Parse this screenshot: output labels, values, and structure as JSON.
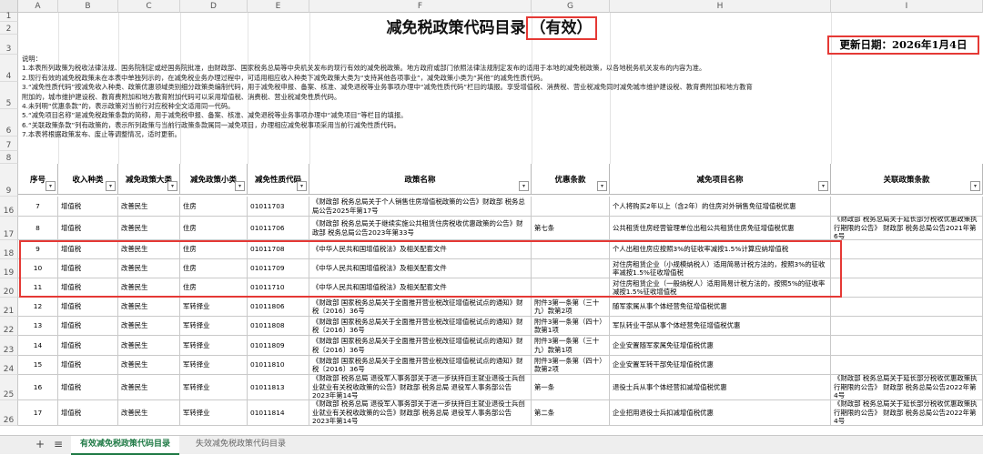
{
  "columns": [
    "A",
    "B",
    "C",
    "D",
    "E",
    "F",
    "G",
    "H",
    "I"
  ],
  "title_main": "减免税政策代码目录",
  "title_highlight": "（有效）",
  "update_date": "更新日期：2026年1月4日",
  "notes": [
    "说明：",
    "1.本表所列政策为税收法律法规、国务院制定或经国务院批准，由财政部、国家税务总局等中央机关发布的现行有效的减免税政策。地方政府或部门依照法律法规制定发布的适用于本地的减免税政策，以各地税务机关发布的内容为准。",
    "2.现行有效的减免税政策未在本表中单独列示的，在减免税业务办理过程中，可适用相应收入种类下减免政策大类为“支持其他各项事业”，减免政策小类为“其他”的减免性质代码。",
    "3.“减免性质代码”按减免收入种类、政策优惠领域类别细分政策类编制代码，用于减免税申报、备案、核准、减免退税等业务事项办理中“减免性质代码”栏目的填报。享受增值税、消费税、营业税减免同时减免城市维护建设税、教育费附加和地方教育",
    "附加的，城市维护建设税、教育费附加和地方教育附加代码可以采用增值税、消费税、营业税减免性质代码。",
    "4.未列明“优惠条款”的，表示政策对当前行对应税种全文适用同一代码。",
    "5.“减免项目名称”是减免税政策条款的简称，用于减免税申报、备案、核准、减免退税等业务事项办理中“减免项目”等栏目的填报。",
    "6.“关联政策条款”列有政策的，表示所列政策与当前行政策条款属同一减免项目，办理相应减免税事项采用当前行减免性质代码。",
    "7.本表将根据政策发布、废止等调整情况，适时更新。"
  ],
  "table_headers": [
    "序号",
    "收入种类",
    "减免政策大类",
    "减免政策小类",
    "减免性质代码",
    "政策名称",
    "优惠条款",
    "减免项目名称",
    "关联政策条款"
  ],
  "rows": [
    {
      "rn": "16",
      "seq": "7",
      "tax": "增值税",
      "cat": "改善民生",
      "sub": "住房",
      "code": "01011703",
      "policy": "《财政部 税务总局关于个人销售住房增值税政策的公告》财政部 税务总局公告2025年第17号",
      "clause": "",
      "item": "个人将购买2年以上（含2年）的住房对外销售免征增值税优惠",
      "related": ""
    },
    {
      "rn": "17",
      "seq": "8",
      "tax": "增值税",
      "cat": "改善民生",
      "sub": "住房",
      "code": "01011706",
      "policy": "《财政部 税务总局关于继续实施公共租赁住房税收优惠政策的公告》财政部 税务总局公告2023年第33号",
      "clause": "第七条",
      "item": "公共租赁住房经营管理单位出租公共租赁住房免征增值税优惠",
      "related": "《财政部 税务总局关于延长部分税收优惠政策执行期限的公告》 财政部 税务总局公告2021年第6号"
    },
    {
      "rn": "18",
      "seq": "9",
      "tax": "增值税",
      "cat": "改善民生",
      "sub": "住房",
      "code": "01011708",
      "policy": "《中华人民共和国增值税法》及相关配套文件",
      "clause": "",
      "item": "个人出租住房应按照3%的征收率减按1.5%计算应纳增值税",
      "related": ""
    },
    {
      "rn": "19",
      "seq": "10",
      "tax": "增值税",
      "cat": "改善民生",
      "sub": "住房",
      "code": "01011709",
      "policy": "《中华人民共和国增值税法》及相关配套文件",
      "clause": "",
      "item": "对住房租赁企业（小规模纳税人）适用简易计税方法的，按照3%的征收率减按1.5%征收增值税",
      "related": ""
    },
    {
      "rn": "20",
      "seq": "11",
      "tax": "增值税",
      "cat": "改善民生",
      "sub": "住房",
      "code": "01011710",
      "policy": "《中华人民共和国增值税法》及相关配套文件",
      "clause": "",
      "item": "对住房租赁企业（一般纳税人）适用简易计税方法的，按照5%的征收率减按1.5%征收增值税",
      "related": ""
    },
    {
      "rn": "21",
      "seq": "12",
      "tax": "增值税",
      "cat": "改善民生",
      "sub": "军转择业",
      "code": "01011806",
      "policy": "《财政部 国家税务总局关于全面推开营业税改征增值税试点的通知》财税〔2016〕36号",
      "clause": "附件3第一条第（三十九）款第2项",
      "item": "随军家属从事个体经营免征增值税优惠",
      "related": ""
    },
    {
      "rn": "22",
      "seq": "13",
      "tax": "增值税",
      "cat": "改善民生",
      "sub": "军转择业",
      "code": "01011808",
      "policy": "《财政部 国家税务总局关于全面推开营业税改征增值税试点的通知》财税〔2016〕36号",
      "clause": "附件3第一条第（四十）款第1项",
      "item": "军队转业干部从事个体经营免征增值税优惠",
      "related": ""
    },
    {
      "rn": "23",
      "seq": "14",
      "tax": "增值税",
      "cat": "改善民生",
      "sub": "军转择业",
      "code": "01011809",
      "policy": "《财政部 国家税务总局关于全面推开营业税改征增值税试点的通知》财税〔2016〕36号",
      "clause": "附件3第一条第（三十九）款第1项",
      "item": "企业安置随军家属免征增值税优惠",
      "related": ""
    },
    {
      "rn": "24",
      "seq": "15",
      "tax": "增值税",
      "cat": "改善民生",
      "sub": "军转择业",
      "code": "01011810",
      "policy": "《财政部 国家税务总局关于全面推开营业税改征增值税试点的通知》财税〔2016〕36号",
      "clause": "附件3第一条第（四十）款第2项",
      "item": "企业安置军转干部免征增值税优惠",
      "related": ""
    },
    {
      "rn": "25",
      "seq": "16",
      "tax": "增值税",
      "cat": "改善民生",
      "sub": "军转择业",
      "code": "01011813",
      "policy": "《财政部 税务总局 退役军人事务部关于进一步扶持自主就业退役士兵创业就业有关税收政策的公告》财政部 税务总局 退役军人事务部公告2023年第14号",
      "clause": "第一条",
      "item": "退役士兵从事个体经营扣减增值税优惠",
      "related": "《财政部 税务总局关于延长部分税收优惠政策执行期限的公告》 财政部 税务总局公告2022年第4号"
    },
    {
      "rn": "26",
      "seq": "17",
      "tax": "增值税",
      "cat": "改善民生",
      "sub": "军转择业",
      "code": "01011814",
      "policy": "《财政部 税务总局 退役军人事务部关于进一步扶持自主就业退役士兵创业就业有关税收政策的公告》财政部 税务总局 退役军人事务部公告2023年第14号",
      "clause": "第二条",
      "item": "企业招用退役士兵扣减增值税优惠",
      "related": "《财政部 税务总局关于延长部分税收优惠政策执行期限的公告》 财政部 税务总局公告2022年第4号"
    }
  ],
  "bottom": {
    "add_symbol": "+",
    "menu_symbol": "≡",
    "tabs": [
      "有效减免税政策代码目录",
      "失效减免税政策代码目录"
    ]
  }
}
